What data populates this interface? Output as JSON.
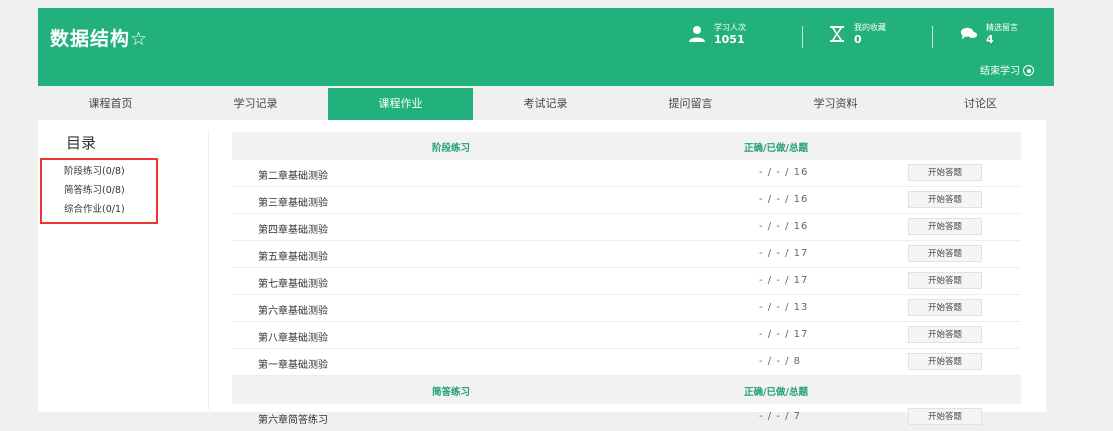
{
  "header": {
    "course_title": "数据结构☆",
    "stats": [
      {
        "label": "学习人次",
        "value": "1051",
        "icon": "user-icon"
      },
      {
        "label": "我的收藏",
        "value": "0",
        "icon": "hourglass-icon"
      },
      {
        "label": "精选留言",
        "value": "4",
        "icon": "chat-icon"
      }
    ],
    "end_study": "结束学习",
    "brand_color": "#22b07d"
  },
  "nav": {
    "tabs": [
      "课程首页",
      "学习记录",
      "课程作业",
      "考试记录",
      "提问留言",
      "学习资料",
      "讨论区"
    ],
    "active": "课程作业"
  },
  "toc": {
    "title": "目录",
    "items": [
      "阶段练习(0/8)",
      "简答练习(0/8)",
      "综合作业(0/1)"
    ]
  },
  "sections": [
    {
      "name": "阶段练习",
      "col_header": "正确/已做/总题",
      "rows": [
        {
          "name": "第二章基础测验",
          "score": "- / - / 16",
          "button": "开始答题"
        },
        {
          "name": "第三章基础测验",
          "score": "- / - / 16",
          "button": "开始答题"
        },
        {
          "name": "第四章基础测验",
          "score": "- / - / 16",
          "button": "开始答题"
        },
        {
          "name": "第五章基础测验",
          "score": "- / - / 17",
          "button": "开始答题"
        },
        {
          "name": "第七章基础测验",
          "score": "- / - / 17",
          "button": "开始答题"
        },
        {
          "name": "第六章基础测验",
          "score": "- / - / 13",
          "button": "开始答题"
        },
        {
          "name": "第八章基础测验",
          "score": "- / - / 17",
          "button": "开始答题"
        },
        {
          "name": "第一章基础测验",
          "score": "- / - / 8",
          "button": "开始答题"
        }
      ]
    },
    {
      "name": "简答练习",
      "col_header": "正确/已做/总题",
      "rows": [
        {
          "name": "第六章简答练习",
          "score": "- / - / 7",
          "button": "开始答题"
        }
      ]
    }
  ]
}
